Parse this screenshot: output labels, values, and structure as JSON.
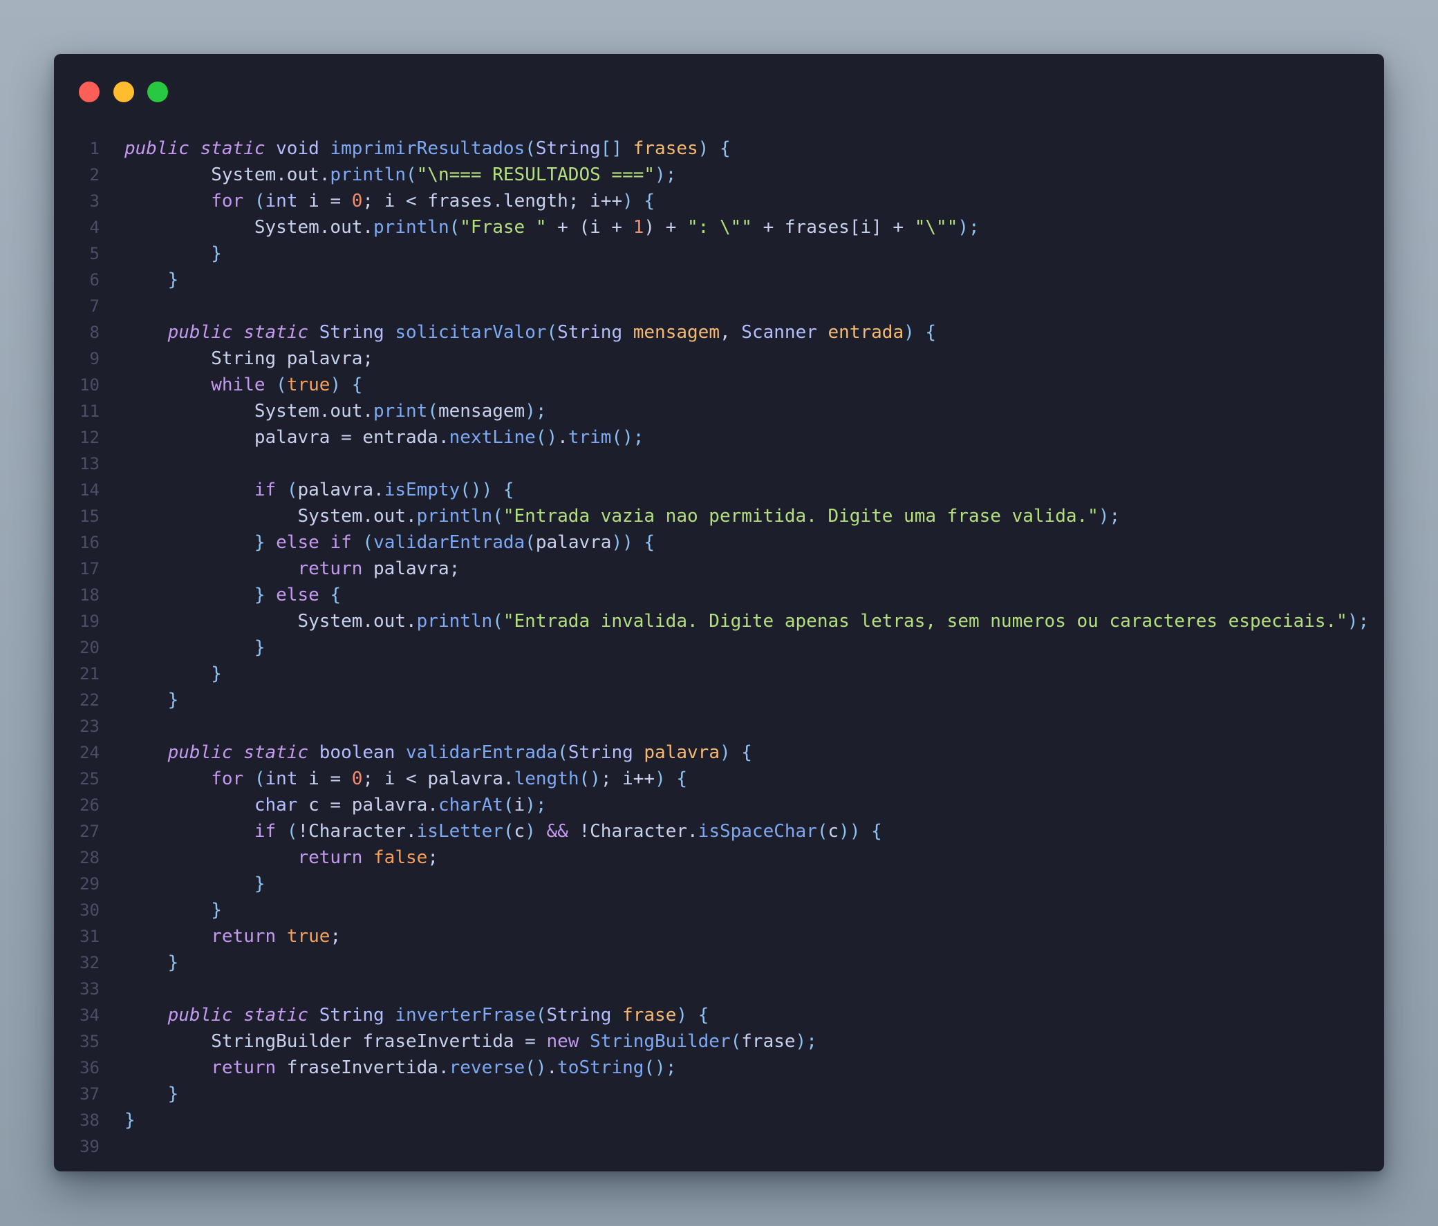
{
  "window": {
    "controls": [
      {
        "name": "close-button",
        "color": "#ff5f57"
      },
      {
        "name": "minimize-button",
        "color": "#febc2e"
      },
      {
        "name": "maximize-button",
        "color": "#28c840"
      }
    ]
  },
  "code": {
    "language": "java",
    "lines": [
      {
        "n": "1",
        "tokens": [
          [
            "modifier",
            "public"
          ],
          [
            "plain",
            " "
          ],
          [
            "modifier",
            "static"
          ],
          [
            "plain",
            " "
          ],
          [
            "type",
            "void"
          ],
          [
            "plain",
            " "
          ],
          [
            "fn",
            "imprimirResultados"
          ],
          [
            "punct",
            "("
          ],
          [
            "type",
            "String"
          ],
          [
            "punct",
            "[]"
          ],
          [
            "plain",
            " "
          ],
          [
            "param",
            "frases"
          ],
          [
            "punct",
            ")"
          ],
          [
            "plain",
            " "
          ],
          [
            "punct",
            "{"
          ]
        ]
      },
      {
        "n": "2",
        "tokens": [
          [
            "plain",
            "        System.out."
          ],
          [
            "fn",
            "println"
          ],
          [
            "punct",
            "("
          ],
          [
            "string",
            "\"\\n=== RESULTADOS ===\""
          ],
          [
            "punct",
            ");"
          ]
        ]
      },
      {
        "n": "3",
        "tokens": [
          [
            "plain",
            "        "
          ],
          [
            "keyword",
            "for"
          ],
          [
            "plain",
            " "
          ],
          [
            "punct",
            "("
          ],
          [
            "type",
            "int"
          ],
          [
            "plain",
            " i = "
          ],
          [
            "number",
            "0"
          ],
          [
            "plain",
            "; i < frases.length; i++"
          ],
          [
            "punct",
            ")"
          ],
          [
            "plain",
            " "
          ],
          [
            "punct",
            "{"
          ]
        ]
      },
      {
        "n": "4",
        "tokens": [
          [
            "plain",
            "            System.out."
          ],
          [
            "fn",
            "println"
          ],
          [
            "punct",
            "("
          ],
          [
            "string",
            "\"Frase \""
          ],
          [
            "plain",
            " + (i + "
          ],
          [
            "number",
            "1"
          ],
          [
            "plain",
            ") + "
          ],
          [
            "string",
            "\": \\\"\""
          ],
          [
            "plain",
            " + frases[i] + "
          ],
          [
            "string",
            "\"\\\"\""
          ],
          [
            "punct",
            ");"
          ]
        ]
      },
      {
        "n": "5",
        "tokens": [
          [
            "plain",
            "        "
          ],
          [
            "punct",
            "}"
          ]
        ]
      },
      {
        "n": "6",
        "tokens": [
          [
            "plain",
            "    "
          ],
          [
            "punct",
            "}"
          ]
        ]
      },
      {
        "n": "7",
        "tokens": []
      },
      {
        "n": "8",
        "tokens": [
          [
            "plain",
            "    "
          ],
          [
            "modifier",
            "public"
          ],
          [
            "plain",
            " "
          ],
          [
            "modifier",
            "static"
          ],
          [
            "plain",
            " "
          ],
          [
            "type",
            "String"
          ],
          [
            "plain",
            " "
          ],
          [
            "fn",
            "solicitarValor"
          ],
          [
            "punct",
            "("
          ],
          [
            "type",
            "String"
          ],
          [
            "plain",
            " "
          ],
          [
            "param",
            "mensagem"
          ],
          [
            "plain",
            ", "
          ],
          [
            "type",
            "Scanner"
          ],
          [
            "plain",
            " "
          ],
          [
            "param",
            "entrada"
          ],
          [
            "punct",
            ")"
          ],
          [
            "plain",
            " "
          ],
          [
            "punct",
            "{"
          ]
        ]
      },
      {
        "n": "9",
        "tokens": [
          [
            "plain",
            "        String palavra;"
          ]
        ]
      },
      {
        "n": "10",
        "tokens": [
          [
            "plain",
            "        "
          ],
          [
            "keyword",
            "while"
          ],
          [
            "plain",
            " "
          ],
          [
            "punct",
            "("
          ],
          [
            "bool",
            "true"
          ],
          [
            "punct",
            ")"
          ],
          [
            "plain",
            " "
          ],
          [
            "punct",
            "{"
          ]
        ]
      },
      {
        "n": "11",
        "tokens": [
          [
            "plain",
            "            System.out."
          ],
          [
            "fn",
            "print"
          ],
          [
            "punct",
            "("
          ],
          [
            "plain",
            "mensagem"
          ],
          [
            "punct",
            ");"
          ]
        ]
      },
      {
        "n": "12",
        "tokens": [
          [
            "plain",
            "            palavra = entrada."
          ],
          [
            "fn",
            "nextLine"
          ],
          [
            "punct",
            "()"
          ],
          [
            "plain",
            "."
          ],
          [
            "fn",
            "trim"
          ],
          [
            "punct",
            "();"
          ]
        ]
      },
      {
        "n": "13",
        "tokens": []
      },
      {
        "n": "14",
        "tokens": [
          [
            "plain",
            "            "
          ],
          [
            "keyword",
            "if"
          ],
          [
            "plain",
            " "
          ],
          [
            "punct",
            "("
          ],
          [
            "plain",
            "palavra."
          ],
          [
            "fn",
            "isEmpty"
          ],
          [
            "punct",
            "())"
          ],
          [
            "plain",
            " "
          ],
          [
            "punct",
            "{"
          ]
        ]
      },
      {
        "n": "15",
        "tokens": [
          [
            "plain",
            "                System.out."
          ],
          [
            "fn",
            "println"
          ],
          [
            "punct",
            "("
          ],
          [
            "string",
            "\"Entrada vazia nao permitida. Digite uma frase valida.\""
          ],
          [
            "punct",
            ");"
          ]
        ]
      },
      {
        "n": "16",
        "tokens": [
          [
            "plain",
            "            "
          ],
          [
            "punct",
            "}"
          ],
          [
            "plain",
            " "
          ],
          [
            "keyword",
            "else"
          ],
          [
            "plain",
            " "
          ],
          [
            "keyword",
            "if"
          ],
          [
            "plain",
            " "
          ],
          [
            "punct",
            "("
          ],
          [
            "fn",
            "validarEntrada"
          ],
          [
            "punct",
            "("
          ],
          [
            "plain",
            "palavra"
          ],
          [
            "punct",
            "))"
          ],
          [
            "plain",
            " "
          ],
          [
            "punct",
            "{"
          ]
        ]
      },
      {
        "n": "17",
        "tokens": [
          [
            "plain",
            "                "
          ],
          [
            "keyword",
            "return"
          ],
          [
            "plain",
            " palavra;"
          ]
        ]
      },
      {
        "n": "18",
        "tokens": [
          [
            "plain",
            "            "
          ],
          [
            "punct",
            "}"
          ],
          [
            "plain",
            " "
          ],
          [
            "keyword",
            "else"
          ],
          [
            "plain",
            " "
          ],
          [
            "punct",
            "{"
          ]
        ]
      },
      {
        "n": "19",
        "tokens": [
          [
            "plain",
            "                System.out."
          ],
          [
            "fn",
            "println"
          ],
          [
            "punct",
            "("
          ],
          [
            "string",
            "\"Entrada invalida. Digite apenas letras, sem numeros ou caracteres especiais.\""
          ],
          [
            "punct",
            ");"
          ]
        ]
      },
      {
        "n": "20",
        "tokens": [
          [
            "plain",
            "            "
          ],
          [
            "punct",
            "}"
          ]
        ]
      },
      {
        "n": "21",
        "tokens": [
          [
            "plain",
            "        "
          ],
          [
            "punct",
            "}"
          ]
        ]
      },
      {
        "n": "22",
        "tokens": [
          [
            "plain",
            "    "
          ],
          [
            "punct",
            "}"
          ]
        ]
      },
      {
        "n": "23",
        "tokens": []
      },
      {
        "n": "24",
        "tokens": [
          [
            "plain",
            "    "
          ],
          [
            "modifier",
            "public"
          ],
          [
            "plain",
            " "
          ],
          [
            "modifier",
            "static"
          ],
          [
            "plain",
            " "
          ],
          [
            "type",
            "boolean"
          ],
          [
            "plain",
            " "
          ],
          [
            "fn",
            "validarEntrada"
          ],
          [
            "punct",
            "("
          ],
          [
            "type",
            "String"
          ],
          [
            "plain",
            " "
          ],
          [
            "param",
            "palavra"
          ],
          [
            "punct",
            ")"
          ],
          [
            "plain",
            " "
          ],
          [
            "punct",
            "{"
          ]
        ]
      },
      {
        "n": "25",
        "tokens": [
          [
            "plain",
            "        "
          ],
          [
            "keyword",
            "for"
          ],
          [
            "plain",
            " "
          ],
          [
            "punct",
            "("
          ],
          [
            "type",
            "int"
          ],
          [
            "plain",
            " i = "
          ],
          [
            "number",
            "0"
          ],
          [
            "plain",
            "; i < palavra."
          ],
          [
            "fn",
            "length"
          ],
          [
            "punct",
            "()"
          ],
          [
            "plain",
            "; i++"
          ],
          [
            "punct",
            ")"
          ],
          [
            "plain",
            " "
          ],
          [
            "punct",
            "{"
          ]
        ]
      },
      {
        "n": "26",
        "tokens": [
          [
            "plain",
            "            "
          ],
          [
            "type",
            "char"
          ],
          [
            "plain",
            " c = palavra."
          ],
          [
            "fn",
            "charAt"
          ],
          [
            "punct",
            "("
          ],
          [
            "plain",
            "i"
          ],
          [
            "punct",
            ");"
          ]
        ]
      },
      {
        "n": "27",
        "tokens": [
          [
            "plain",
            "            "
          ],
          [
            "keyword",
            "if"
          ],
          [
            "plain",
            " "
          ],
          [
            "punct",
            "("
          ],
          [
            "plain",
            "!Character."
          ],
          [
            "fn",
            "isLetter"
          ],
          [
            "punct",
            "("
          ],
          [
            "plain",
            "c"
          ],
          [
            "punct",
            ")"
          ],
          [
            "plain",
            " "
          ],
          [
            "keyword",
            "&&"
          ],
          [
            "plain",
            " !Character."
          ],
          [
            "fn",
            "isSpaceChar"
          ],
          [
            "punct",
            "("
          ],
          [
            "plain",
            "c"
          ],
          [
            "punct",
            "))"
          ],
          [
            "plain",
            " "
          ],
          [
            "punct",
            "{"
          ]
        ]
      },
      {
        "n": "28",
        "tokens": [
          [
            "plain",
            "                "
          ],
          [
            "keyword",
            "return"
          ],
          [
            "plain",
            " "
          ],
          [
            "bool",
            "false"
          ],
          [
            "plain",
            ";"
          ]
        ]
      },
      {
        "n": "29",
        "tokens": [
          [
            "plain",
            "            "
          ],
          [
            "punct",
            "}"
          ]
        ]
      },
      {
        "n": "30",
        "tokens": [
          [
            "plain",
            "        "
          ],
          [
            "punct",
            "}"
          ]
        ]
      },
      {
        "n": "31",
        "tokens": [
          [
            "plain",
            "        "
          ],
          [
            "keyword",
            "return"
          ],
          [
            "plain",
            " "
          ],
          [
            "bool",
            "true"
          ],
          [
            "plain",
            ";"
          ]
        ]
      },
      {
        "n": "32",
        "tokens": [
          [
            "plain",
            "    "
          ],
          [
            "punct",
            "}"
          ]
        ]
      },
      {
        "n": "33",
        "tokens": []
      },
      {
        "n": "34",
        "tokens": [
          [
            "plain",
            "    "
          ],
          [
            "modifier",
            "public"
          ],
          [
            "plain",
            " "
          ],
          [
            "modifier",
            "static"
          ],
          [
            "plain",
            " "
          ],
          [
            "type",
            "String"
          ],
          [
            "plain",
            " "
          ],
          [
            "fn",
            "inverterFrase"
          ],
          [
            "punct",
            "("
          ],
          [
            "type",
            "String"
          ],
          [
            "plain",
            " "
          ],
          [
            "param",
            "frase"
          ],
          [
            "punct",
            ")"
          ],
          [
            "plain",
            " "
          ],
          [
            "punct",
            "{"
          ]
        ]
      },
      {
        "n": "35",
        "tokens": [
          [
            "plain",
            "        StringBuilder fraseInvertida = "
          ],
          [
            "keyword",
            "new"
          ],
          [
            "plain",
            " "
          ],
          [
            "fn",
            "StringBuilder"
          ],
          [
            "punct",
            "("
          ],
          [
            "plain",
            "frase"
          ],
          [
            "punct",
            ");"
          ]
        ]
      },
      {
        "n": "36",
        "tokens": [
          [
            "plain",
            "        "
          ],
          [
            "keyword",
            "return"
          ],
          [
            "plain",
            " fraseInvertida."
          ],
          [
            "fn",
            "reverse"
          ],
          [
            "punct",
            "()"
          ],
          [
            "plain",
            "."
          ],
          [
            "fn",
            "toString"
          ],
          [
            "punct",
            "();"
          ]
        ]
      },
      {
        "n": "37",
        "tokens": [
          [
            "plain",
            "    "
          ],
          [
            "punct",
            "}"
          ]
        ]
      },
      {
        "n": "38",
        "tokens": [
          [
            "punct",
            "}"
          ]
        ]
      },
      {
        "n": "39",
        "tokens": []
      }
    ]
  }
}
